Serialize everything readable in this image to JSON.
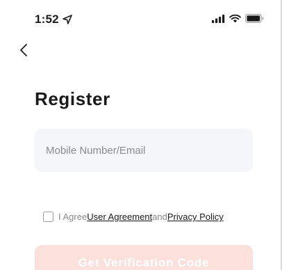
{
  "status_bar": {
    "time": "1:52",
    "icons": [
      "location-arrow-icon",
      "cellular-signal-icon",
      "wifi-icon",
      "battery-icon"
    ]
  },
  "nav": {
    "back_icon": "chevron-left-icon"
  },
  "register": {
    "title": "Register",
    "input_placeholder": "Mobile Number/Email",
    "input_value": ""
  },
  "agreement": {
    "prefix": "I Agree",
    "user_agreement": "User Agreement",
    "conjunction": "and",
    "privacy_policy": "Privacy Policy",
    "checked": false
  },
  "cta": {
    "label": "Get Verification Code",
    "enabled": false,
    "color": "#fbe0dc"
  }
}
